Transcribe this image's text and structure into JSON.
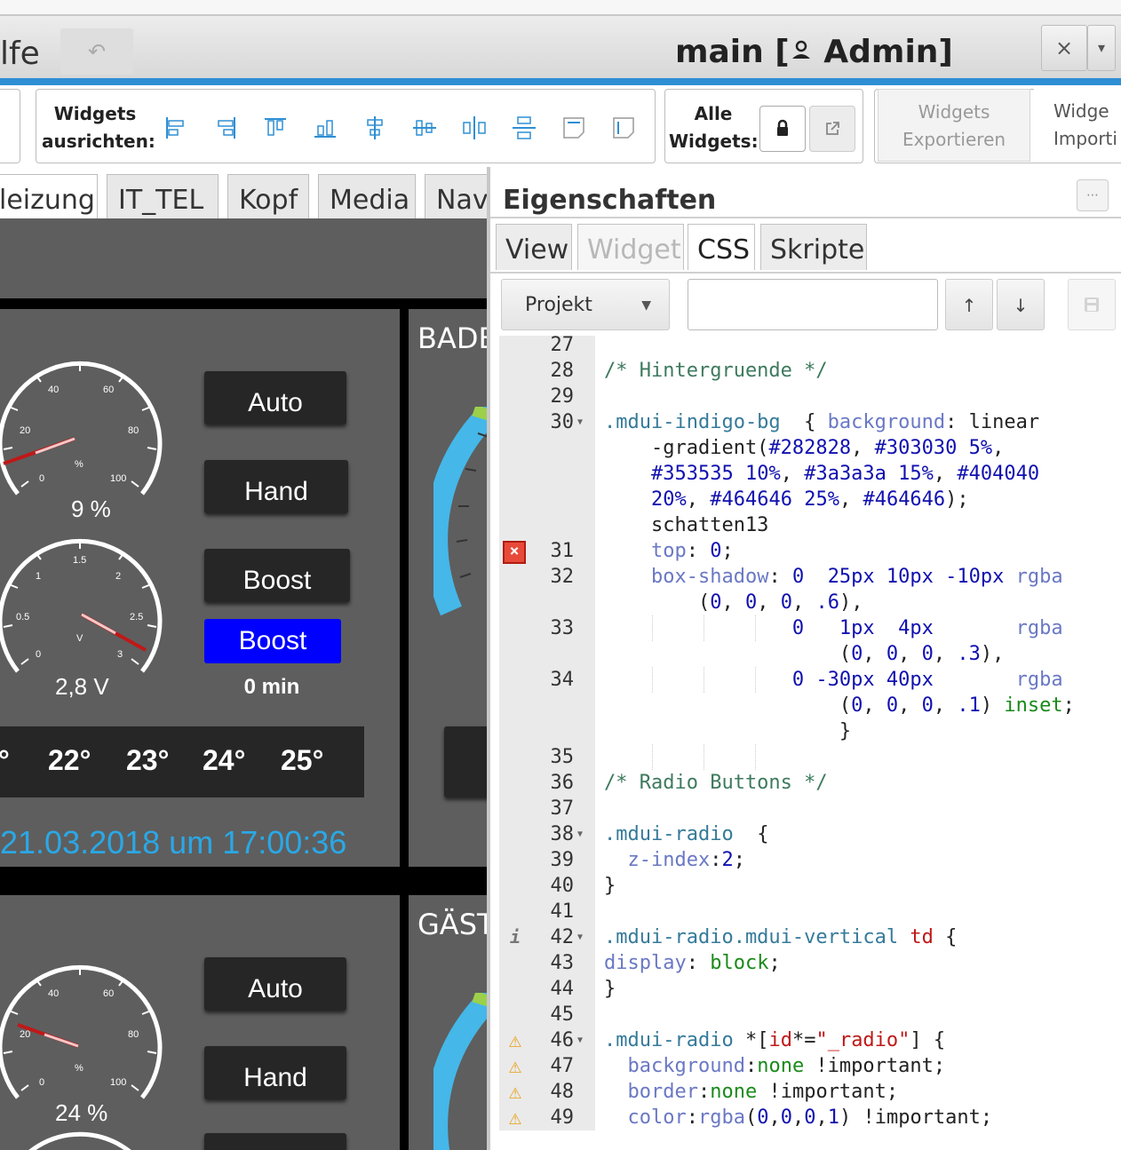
{
  "window": {
    "menu_partial": "lfe",
    "undo_icon": "↶",
    "title": "main [",
    "title_user_icon": "user-icon",
    "title_user": " Admin]",
    "close": "×",
    "dropdown": "▾"
  },
  "toolbar": {
    "align_label_1": "Widgets",
    "align_label_2": "ausrichten:",
    "align_icons": [
      "align-left-icon",
      "align-right-icon",
      "align-top-icon",
      "align-bottom-icon",
      "align-center-vertical-icon",
      "align-center-horizontal-icon",
      "distribute-horizontal-icon",
      "distribute-vertical-icon",
      "same-width-icon",
      "same-height-icon"
    ],
    "all_label_1": "Alle",
    "all_label_2": "Widgets:",
    "lock_icon": "lock-icon",
    "external_icon": "external-link-icon",
    "export_1": "Widgets",
    "export_2": "Exportieren",
    "import_1": "Widge",
    "import_2": "Importi"
  },
  "left_tabs": [
    "leizung",
    "IT_TEL",
    "Kopf",
    "Media",
    "Nav"
  ],
  "room1": {
    "label": "BADE",
    "gauge1": {
      "value_text": "9 %",
      "value": 9,
      "unit": "%",
      "ticks": [
        "0",
        "20",
        "40",
        "60",
        "80",
        "100"
      ]
    },
    "gauge2": {
      "value_text": "2,8 V",
      "value": 2.8,
      "unit": "V",
      "ticks": [
        "0",
        "0.5",
        "1",
        "1.5",
        "2",
        "2.5",
        "3"
      ]
    },
    "btn_auto": "Auto",
    "btn_hand": "Hand",
    "btn_boost": "Boost",
    "btn_boost_active": "Boost",
    "boost_time": "0 min",
    "temps": [
      "°",
      "22°",
      "23°",
      "24°",
      "25°"
    ],
    "date": "21.03.2018 um 17:00:36"
  },
  "room2": {
    "label": "GÄST",
    "gauge1": {
      "value_text": "24 %",
      "value": 24,
      "unit": "%",
      "ticks": [
        "0",
        "20",
        "40",
        "60",
        "80",
        "100"
      ]
    },
    "btn_auto": "Auto",
    "btn_hand": "Hand"
  },
  "props": {
    "title": "Eigenschaften",
    "menu_icon": "menu-icon",
    "tabs": [
      "View",
      "Widget",
      "CSS",
      "Skripte"
    ],
    "projekt": "Projekt",
    "up": "↑",
    "down": "↓",
    "save_icon": "save-icon"
  },
  "code_lines": {
    "n27": "27",
    "n28": "28",
    "n29": "29",
    "n30": "30",
    "n31": "31",
    "n32": "32",
    "n33": "33",
    "n34": "34",
    "n35": "35",
    "n36": "36",
    "n37": "37",
    "n38": "38",
    "n39": "39",
    "n40": "40",
    "n41": "41",
    "n42": "42",
    "n43": "43",
    "n44": "44",
    "n45": "45",
    "n46": "46",
    "n47": "47",
    "n48": "48",
    "n49": "49"
  },
  "colors": {
    "accent_blue": "#2e8fd4",
    "boost_blue": "#0000ff",
    "dark_button": "#262626",
    "panel_grey": "#5e5e5e",
    "date_blue": "#2aa8e6",
    "gauge_blue": "#45b7e8"
  }
}
